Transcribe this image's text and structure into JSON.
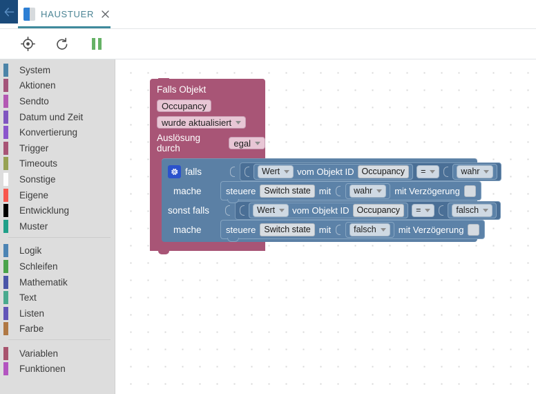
{
  "window": {
    "back_icon": "back-arrow-icon"
  },
  "tab": {
    "icon": "script-icon",
    "title": "HAUSTUER",
    "close_icon": "close-icon",
    "accent_color": "#3f8a9c"
  },
  "toolbar": {
    "buttons": [
      {
        "name": "locate-button",
        "icon": "crosshair-icon"
      },
      {
        "name": "reload-button",
        "icon": "refresh-icon"
      },
      {
        "name": "pause-button",
        "icon": "pause-icon",
        "color": "#66b266"
      }
    ]
  },
  "sidebar": {
    "groups": [
      {
        "items": [
          {
            "label": "System",
            "color": "#4c84a8"
          },
          {
            "label": "Aktionen",
            "color": "#a4557a"
          },
          {
            "label": "Sendto",
            "color": "#b359b3"
          },
          {
            "label": "Datum und Zeit",
            "color": "#8056c0"
          },
          {
            "label": "Konvertierung",
            "color": "#8b56cc"
          },
          {
            "label": "Trigger",
            "color": "#a85576"
          },
          {
            "label": "Timeouts",
            "color": "#97a253"
          },
          {
            "label": "Sonstige",
            "color": "#fdfdfd"
          },
          {
            "label": "Eigene",
            "color": "#f8584e"
          },
          {
            "label": "Entwicklung",
            "color": "#000000"
          },
          {
            "label": "Muster",
            "color": "#20a089"
          }
        ]
      },
      {
        "items": [
          {
            "label": "Logik",
            "color": "#4c84b4"
          },
          {
            "label": "Schleifen",
            "color": "#4aa34a"
          },
          {
            "label": "Mathematik",
            "color": "#4a55a8"
          },
          {
            "label": "Text",
            "color": "#4aaa8e"
          },
          {
            "label": "Listen",
            "color": "#6355b8"
          },
          {
            "label": "Farbe",
            "color": "#b07844"
          }
        ]
      },
      {
        "items": [
          {
            "label": "Variablen",
            "color": "#a8546e"
          },
          {
            "label": "Funktionen",
            "color": "#b355c0"
          }
        ]
      }
    ]
  },
  "canvas": {
    "trigger_block": {
      "color": "#a85576",
      "title": "Falls Objekt",
      "object_id": "Occupancy",
      "condition": "wurde aktualisiert",
      "trigger_by_label": "Auslösung durch",
      "trigger_by_value": "egal"
    },
    "if_block": {
      "color": "#5b80a5",
      "gear_icon": "gear-icon",
      "if_label": "falls",
      "do_label_1": "mache",
      "elseif_label": "sonst falls",
      "do_label_2": "mache",
      "condition_1": {
        "value_type": "Wert",
        "from_object_label": "vom Objekt ID",
        "object_id": "Occupancy",
        "operator": "=",
        "compare_value": "wahr"
      },
      "statement_1": {
        "control_label": "steuere",
        "target": "Switch state",
        "with_label": "mit",
        "value": "wahr",
        "delay_label": "mit Verzögerung",
        "delay_checked": false
      },
      "condition_2": {
        "value_type": "Wert",
        "from_object_label": "vom Objekt ID",
        "object_id": "Occupancy",
        "operator": "=",
        "compare_value": "falsch"
      },
      "statement_2": {
        "control_label": "steuere",
        "target": "Switch state",
        "with_label": "mit",
        "value": "falsch",
        "delay_label": "mit Verzögerung",
        "delay_checked": false
      }
    }
  }
}
